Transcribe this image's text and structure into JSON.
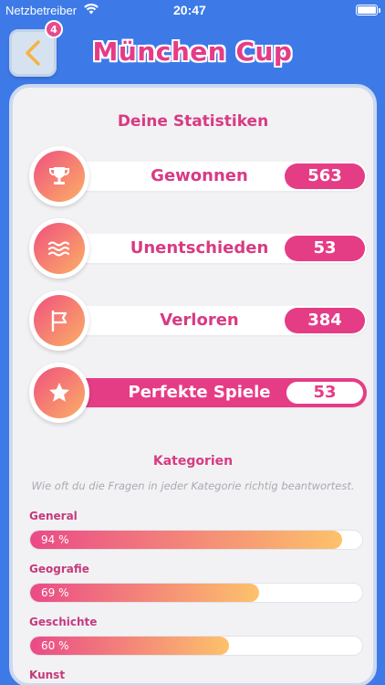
{
  "status_bar": {
    "carrier": "Netzbetreiber",
    "time": "20:47"
  },
  "header": {
    "title": "München Cup",
    "back_badge": "4"
  },
  "stats": {
    "title": "Deine Statistiken",
    "items": [
      {
        "label": "Gewonnen",
        "value": "563",
        "icon": "trophy-icon"
      },
      {
        "label": "Unentschieden",
        "value": "53",
        "icon": "waves-icon"
      },
      {
        "label": "Verloren",
        "value": "384",
        "icon": "flag-icon"
      },
      {
        "label": "Perfekte Spiele",
        "value": "53",
        "icon": "star-icon"
      }
    ]
  },
  "categories": {
    "title": "Kategorien",
    "description": "Wie oft du die Fragen in jeder Kategorie richtig beantwortest.",
    "items": [
      {
        "name": "General",
        "percent": 94,
        "label": "94 %"
      },
      {
        "name": "Geografie",
        "percent": 69,
        "label": "69 %"
      },
      {
        "name": "Geschichte",
        "percent": 60,
        "label": "60 %"
      },
      {
        "name": "Kunst",
        "percent": null,
        "label": ""
      }
    ]
  },
  "colors": {
    "background": "#3d7ae8",
    "accent": "#e53c86",
    "gradient_start": "#ea4a87",
    "gradient_end": "#fdc26b"
  }
}
